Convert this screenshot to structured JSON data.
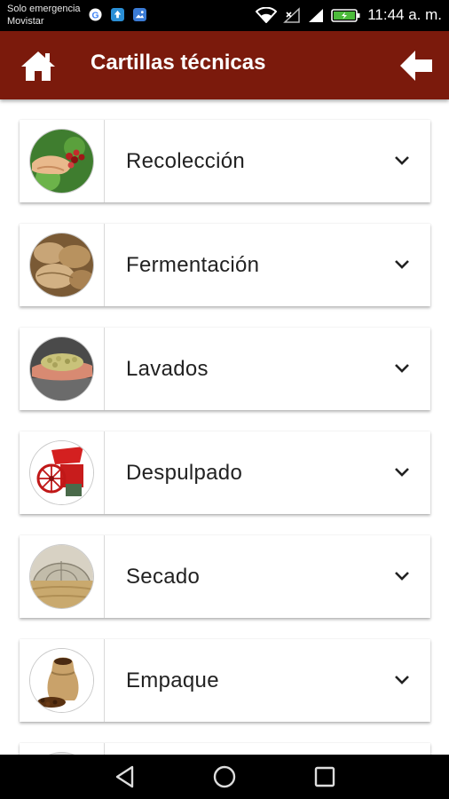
{
  "status_bar": {
    "carrier_line1": "Solo emergencia",
    "carrier_line2": "Movistar",
    "time": "11:44 a. m.",
    "icons": [
      "google-icon",
      "upload-icon",
      "image-icon",
      "wifi-icon",
      "no-signal-icon",
      "signal-icon",
      "battery-icon"
    ]
  },
  "app_bar": {
    "title": "Cartillas técnicas",
    "home_icon": "home-icon",
    "back_icon": "back-arrow-icon",
    "color": "#7b1a0c"
  },
  "items": [
    {
      "label": "Recolección",
      "image": "harvest-hand-cherries"
    },
    {
      "label": "Fermentación",
      "image": "fermentation-beans"
    },
    {
      "label": "Lavados",
      "image": "washed-beans-hands"
    },
    {
      "label": "Despulpado",
      "image": "red-pulper-machine"
    },
    {
      "label": "Secado",
      "image": "drying-greenhouse"
    },
    {
      "label": "Empaque",
      "image": "coffee-sack"
    }
  ],
  "nav_bar": {
    "icons": [
      "nav-back-icon",
      "nav-home-icon",
      "nav-recent-icon"
    ]
  }
}
